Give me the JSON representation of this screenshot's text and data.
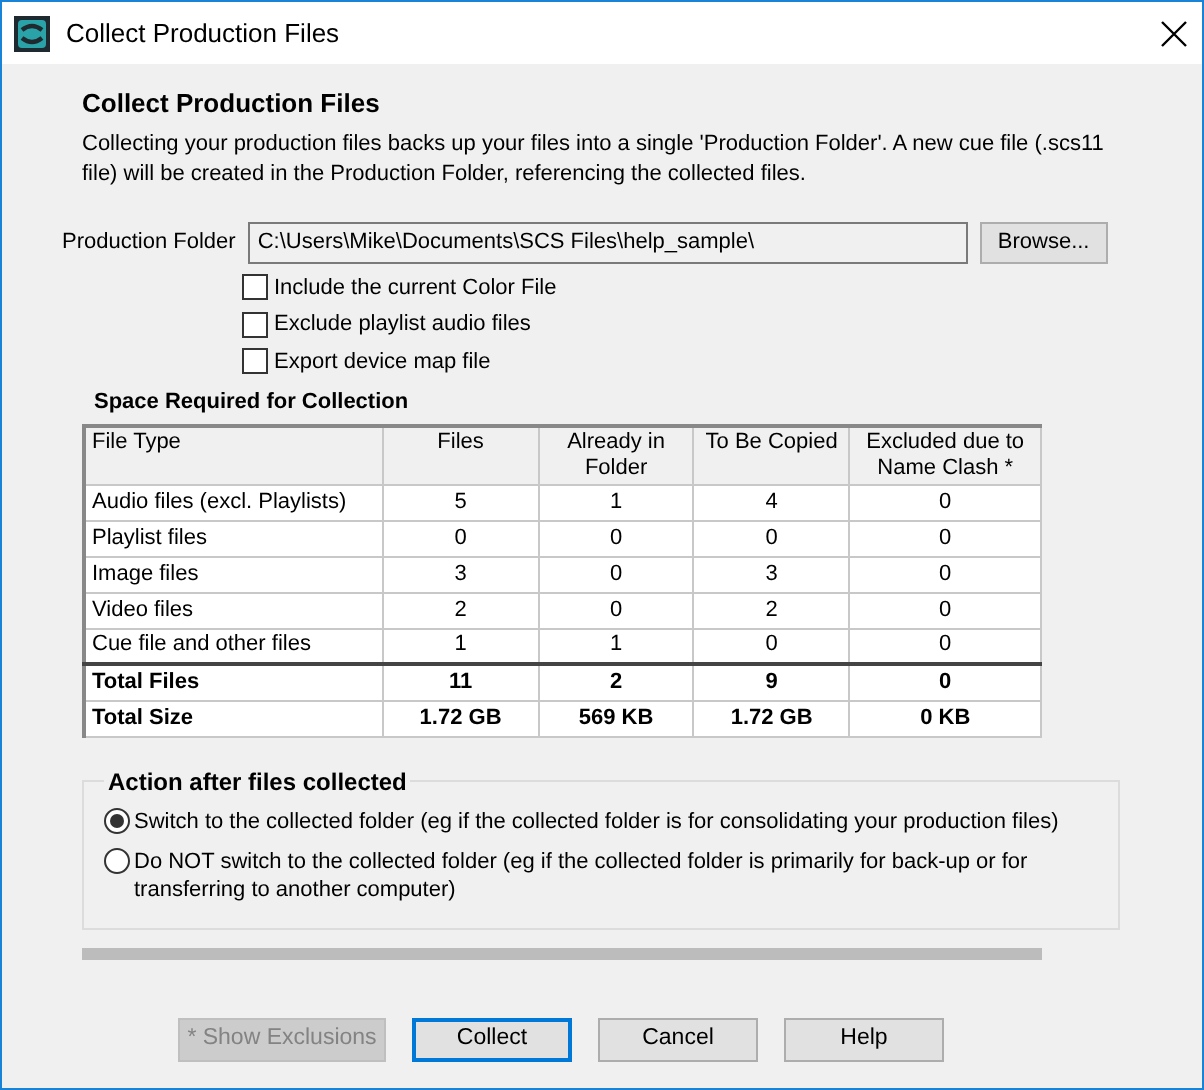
{
  "window": {
    "title": "Collect Production Files"
  },
  "heading": "Collect Production Files",
  "description": "Collecting your production files backs up your files into a single 'Production Folder'. A new cue file (.scs11 file) will be created in the Production Folder, referencing the collected files.",
  "folder": {
    "label": "Production Folder",
    "value": "C:\\Users\\Mike\\Documents\\SCS Files\\help_sample\\",
    "button": "Browse..."
  },
  "options": [
    {
      "label": "Include the current Color File",
      "checked": false
    },
    {
      "label": "Exclude playlist audio files",
      "checked": false
    },
    {
      "label": "Export device map file",
      "checked": false
    }
  ],
  "space": {
    "title": "Space Required for Collection",
    "columns": [
      "File Type",
      "Files",
      "Already in Folder",
      "To Be Copied",
      "Excluded due to Name Clash *"
    ],
    "rows": [
      {
        "total": false,
        "cells": [
          "Audio files (excl. Playlists)",
          "5",
          "1",
          "4",
          "0"
        ]
      },
      {
        "total": false,
        "cells": [
          "Playlist files",
          "0",
          "0",
          "0",
          "0"
        ]
      },
      {
        "total": false,
        "cells": [
          "Image files",
          "3",
          "0",
          "3",
          "0"
        ]
      },
      {
        "total": false,
        "cells": [
          "Video files",
          "2",
          "0",
          "2",
          "0"
        ]
      },
      {
        "total": false,
        "cells": [
          "Cue file and other files",
          "1",
          "1",
          "0",
          "0"
        ]
      },
      {
        "total": true,
        "cells": [
          "Total Files",
          "11",
          "2",
          "9",
          "0"
        ]
      },
      {
        "total": true,
        "cells": [
          "Total Size",
          "1.72 GB",
          "569 KB",
          "1.72 GB",
          "0 KB"
        ]
      }
    ]
  },
  "action": {
    "title": "Action after files collected",
    "choices": [
      {
        "label": "Switch to the collected folder (eg if the collected folder is for consolidating your production files)",
        "selected": true
      },
      {
        "label": "Do NOT switch to the collected folder (eg if the collected folder is primarily for back-up or for transferring to another computer)",
        "selected": false
      }
    ]
  },
  "progress": {
    "level": 0
  },
  "buttons": [
    {
      "label": "* Show Exclusions",
      "disabled": true,
      "default": false
    },
    {
      "label": "Collect",
      "disabled": false,
      "default": true
    },
    {
      "label": "Cancel",
      "disabled": false,
      "default": false
    },
    {
      "label": "Help",
      "disabled": false,
      "default": false
    }
  ]
}
